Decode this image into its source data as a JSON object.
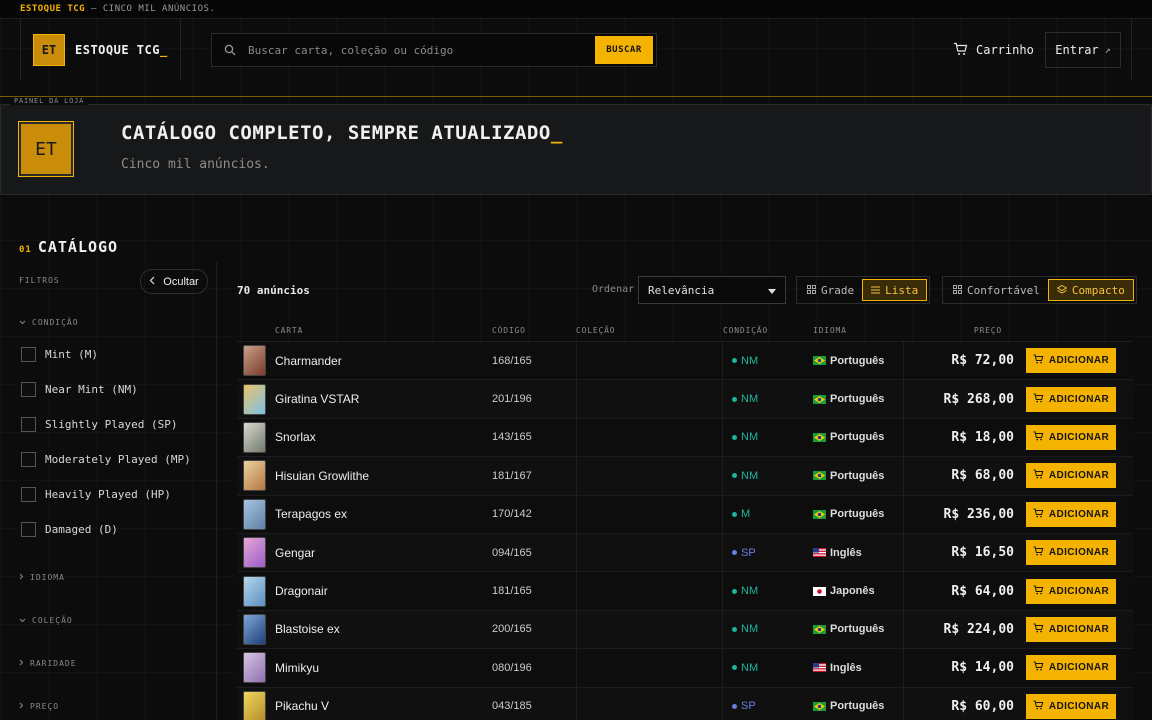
{
  "topbar": {
    "brand": "ESTOQUE TCG",
    "tagline": "— CINCO MIL ANÚNCIOS."
  },
  "header": {
    "logo_initials": "ET",
    "logo_text": "ESTOQUE TCG",
    "logo_cursor": "_",
    "search_placeholder": "Buscar carta, coleção ou código",
    "search_button": "BUSCAR",
    "cart_label": "Carrinho",
    "login_label": "Entrar",
    "login_arrow": "↗"
  },
  "hero": {
    "tag": "PAINEL DA LOJA",
    "initials": "ET",
    "title": "CATÁLOGO COMPLETO, SEMPRE ATUALIZADO",
    "title_cursor": "_",
    "subtitle": "Cinco mil anúncios."
  },
  "sidebar": {
    "section_num": "01",
    "section_title": "CATÁLOGO",
    "filters_label": "FILTROS",
    "hide_label": "Ocultar",
    "condition_head": "CONDIÇÃO",
    "conditions": [
      "Mint (M)",
      "Near Mint (NM)",
      "Slightly Played (SP)",
      "Moderately Played (MP)",
      "Heavily Played (HP)",
      "Damaged (D)"
    ],
    "groups": [
      "IDIOMA",
      "COLEÇÃO",
      "RARIDADE",
      "PREÇO"
    ]
  },
  "toolbar": {
    "count": "70 anúncios",
    "sort_label": "Ordenar",
    "sort_value": "Relevância",
    "view_grid": "Grade",
    "view_list": "Lista",
    "density_comfort": "Confortável",
    "density_compact": "Compacto"
  },
  "table": {
    "headers": {
      "card": "CARTA",
      "code": "CÓDIGO",
      "collection": "COLEÇÃO",
      "condition": "CONDIÇÃO",
      "language": "IDIOMA",
      "price": "PREÇO"
    },
    "add_label": "ADICIONAR",
    "rows": [
      {
        "name": "Charmander",
        "code": "168/165",
        "condition": "NM",
        "cond_color": "#1fb59a",
        "language": "Português",
        "flag": "br",
        "price": "R$ 72,00",
        "thumb": [
          "#c9a08a",
          "#7a3b2a"
        ]
      },
      {
        "name": "Giratina VSTAR",
        "code": "201/196",
        "condition": "NM",
        "cond_color": "#1fb59a",
        "language": "Português",
        "flag": "br",
        "price": "R$ 268,00",
        "thumb": [
          "#e9c26a",
          "#7ec1e6"
        ]
      },
      {
        "name": "Snorlax",
        "code": "143/165",
        "condition": "NM",
        "cond_color": "#1fb59a",
        "language": "Português",
        "flag": "br",
        "price": "R$ 18,00",
        "thumb": [
          "#d8d8cf",
          "#6f7a6b"
        ]
      },
      {
        "name": "Hisuian Growlithe",
        "code": "181/167",
        "condition": "NM",
        "cond_color": "#1fb59a",
        "language": "Português",
        "flag": "br",
        "price": "R$ 68,00",
        "thumb": [
          "#e8d3a0",
          "#b5753e"
        ]
      },
      {
        "name": "Terapagos ex",
        "code": "170/142",
        "condition": "M",
        "cond_color": "#1fb59a",
        "language": "Português",
        "flag": "br",
        "price": "R$ 236,00",
        "thumb": [
          "#a8c5e0",
          "#5f7fa6"
        ]
      },
      {
        "name": "Gengar",
        "code": "094/165",
        "condition": "SP",
        "cond_color": "#6a7fe0",
        "language": "Inglês",
        "flag": "us",
        "price": "R$ 16,50",
        "thumb": [
          "#e7a6d6",
          "#9a5ec7"
        ]
      },
      {
        "name": "Dragonair",
        "code": "181/165",
        "condition": "NM",
        "cond_color": "#1fb59a",
        "language": "Japonês",
        "flag": "jp",
        "price": "R$ 64,00",
        "thumb": [
          "#b6d6ec",
          "#5a8fc0"
        ]
      },
      {
        "name": "Blastoise ex",
        "code": "200/165",
        "condition": "NM",
        "cond_color": "#1fb59a",
        "language": "Português",
        "flag": "br",
        "price": "R$ 224,00",
        "thumb": [
          "#7fa7d8",
          "#1f3f7a"
        ]
      },
      {
        "name": "Mimikyu",
        "code": "080/196",
        "condition": "NM",
        "cond_color": "#1fb59a",
        "language": "Inglês",
        "flag": "us",
        "price": "R$ 14,00",
        "thumb": [
          "#d8c4e6",
          "#8e6fae"
        ]
      },
      {
        "name": "Pikachu V",
        "code": "043/185",
        "condition": "SP",
        "cond_color": "#6a7fe0",
        "language": "Português",
        "flag": "br",
        "price": "R$ 60,00",
        "thumb": [
          "#f0d85a",
          "#b38b2a"
        ]
      }
    ]
  },
  "colors": {
    "accent": "#f5b301",
    "background": "#0c0c0d",
    "nm": "#1fb59a",
    "sp": "#6a7fe0"
  }
}
